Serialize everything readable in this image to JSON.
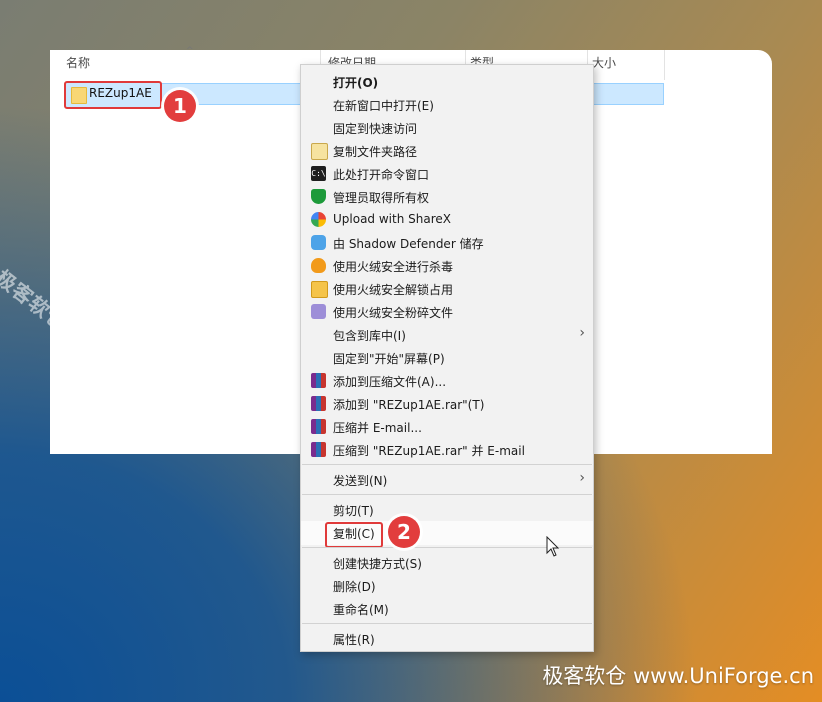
{
  "explorer": {
    "columns": [
      "名称",
      "修改日期",
      "类型",
      "大小"
    ],
    "file_name": "REZup1AE"
  },
  "badges": [
    "1",
    "2"
  ],
  "context_menu": {
    "items": [
      {
        "label": "打开(O)",
        "icon": "none",
        "bold": true
      },
      {
        "label": "在新窗口中打开(E)",
        "icon": "none"
      },
      {
        "label": "固定到快速访问",
        "icon": "none"
      },
      {
        "label": "复制文件夹路径",
        "icon": "clipboard-icon"
      },
      {
        "label": "此处打开命令窗口",
        "icon": "cmd-icon"
      },
      {
        "label": "管理员取得所有权",
        "icon": "shield-icon"
      },
      {
        "label": "Upload with ShareX",
        "icon": "sharex-icon"
      },
      {
        "label": "由 Shadow Defender 储存",
        "icon": "shadow-defender-icon"
      },
      {
        "label": "使用火绒安全进行杀毒",
        "icon": "huorong-icon"
      },
      {
        "label": "使用火绒安全解锁占用",
        "icon": "huorong-unlock-icon"
      },
      {
        "label": "使用火绒安全粉碎文件",
        "icon": "huorong-shred-icon"
      },
      {
        "label": "包含到库中(I)",
        "icon": "none",
        "submenu": true
      },
      {
        "label": "固定到\"开始\"屏幕(P)",
        "icon": "none"
      },
      {
        "label": "添加到压缩文件(A)...",
        "icon": "winrar-icon"
      },
      {
        "label": "添加到 \"REZup1AE.rar\"(T)",
        "icon": "winrar-icon"
      },
      {
        "label": "压缩并 E-mail...",
        "icon": "winrar-icon"
      },
      {
        "label": "压缩到 \"REZup1AE.rar\" 并 E-mail",
        "icon": "winrar-icon"
      },
      {
        "label": "发送到(N)",
        "icon": "none",
        "submenu": true
      },
      {
        "label": "剪切(T)",
        "icon": "none"
      },
      {
        "label": "复制(C)",
        "icon": "none"
      },
      {
        "label": "创建快捷方式(S)",
        "icon": "none"
      },
      {
        "label": "删除(D)",
        "icon": "none"
      },
      {
        "label": "重命名(M)",
        "icon": "none"
      },
      {
        "label": "属性(R)",
        "icon": "none"
      }
    ]
  },
  "watermark": {
    "diagonal": "极客软仓 UniForge.cn",
    "bottom": "极客软仓 www.UniForge.cn"
  },
  "colors": {
    "highlight_red": "#e03a3a",
    "selection_blue": "#cce8ff",
    "menu_bg": "#f2f2f2"
  }
}
